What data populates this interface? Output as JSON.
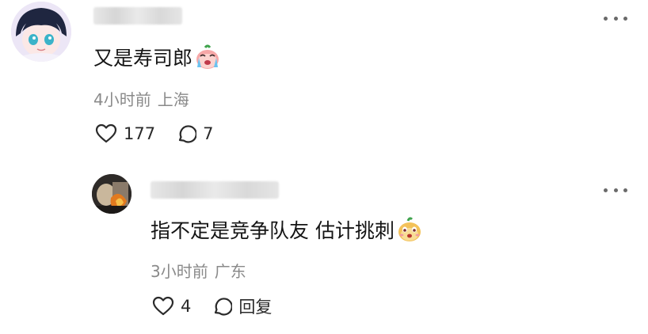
{
  "comment": {
    "text": "又是寿司郎",
    "emoji": "crying-emoji",
    "time": "4小时前",
    "location": "上海",
    "likes": "177",
    "replies": "7"
  },
  "reply": {
    "text": "指不定是竞争队友 估计挑刺",
    "emoji": "smirk-emoji",
    "time": "3小时前",
    "location": "广东",
    "likes": "4",
    "reply_label": "回复"
  },
  "colors": {
    "text": "#151515",
    "meta": "#8a8a8a",
    "icon": "#2a2a2a"
  }
}
